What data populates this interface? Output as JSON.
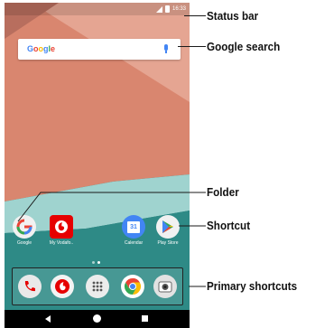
{
  "status_bar": {
    "time": "16:33"
  },
  "search_widget": {
    "logo_text": "Google"
  },
  "home_apps": [
    {
      "label": "Google"
    },
    {
      "label": "My Vodafo.."
    },
    {
      "label": "Calendar",
      "badge": "31"
    },
    {
      "label": "Play Store"
    }
  ],
  "callouts": {
    "status_bar": "Status bar",
    "google_search": "Google search",
    "folder": "Folder",
    "shortcut": "Shortcut",
    "primary_shortcuts": "Primary shortcuts"
  },
  "page_indicator": {
    "pages": 2,
    "current": 2
  },
  "colors": {
    "google_blue": "#4285F4",
    "google_red": "#EA4335",
    "google_yellow": "#FBBC05",
    "google_green": "#34A853",
    "vodafone_red": "#E60000",
    "wallpaper_teal": "#1f6f6c",
    "wallpaper_peach": "#d9866f"
  },
  "icons": [
    "phone-icon",
    "vodafone-icon",
    "apps-grid-icon",
    "chrome-icon",
    "camera-icon"
  ]
}
